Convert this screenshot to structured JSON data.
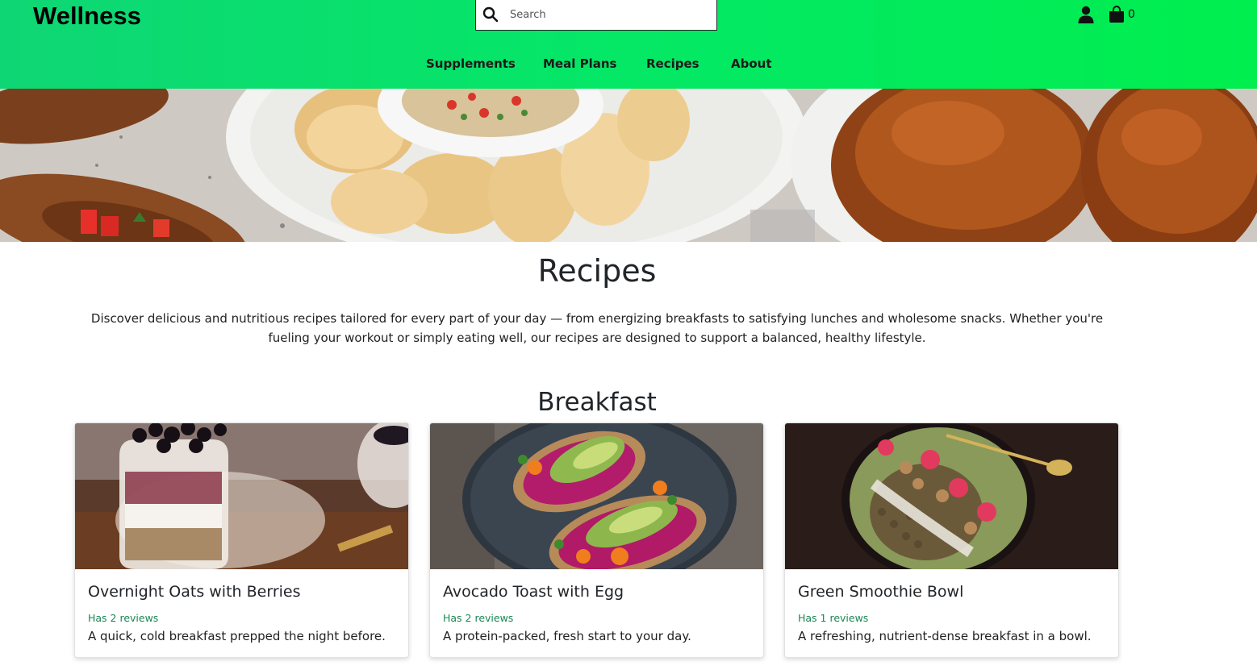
{
  "header": {
    "brand": "Wellness",
    "search": {
      "placeholder": "Search",
      "value": ""
    },
    "cart_count": "0",
    "accent_colors": [
      "#0fd675",
      "#00ee4e"
    ]
  },
  "nav": {
    "items": [
      {
        "label": "Supplements"
      },
      {
        "label": "Meal Plans"
      },
      {
        "label": "Recipes"
      },
      {
        "label": "About"
      }
    ]
  },
  "page": {
    "title": "Recipes",
    "intro": "Discover delicious and nutritious recipes tailored for every part of your day — from energizing breakfasts to satisfying lunches and wholesome snacks. Whether you're fueling your workout or simply eating well, our recipes are designed to support a balanced, healthy lifestyle."
  },
  "sections": [
    {
      "title": "Breakfast",
      "cards": [
        {
          "title": "Overnight Oats with Berries",
          "reviews": "Has 2 reviews",
          "description": "A quick, cold breakfast prepped the night before."
        },
        {
          "title": "Avocado Toast with Egg",
          "reviews": "Has 2 reviews",
          "description": "A protein-packed, fresh start to your day."
        },
        {
          "title": "Green Smoothie Bowl",
          "reviews": "Has 1 reviews",
          "description": "A refreshing, nutrient-dense breakfast in a bowl."
        }
      ]
    }
  ],
  "icons": {
    "search": "search-icon",
    "user": "user-icon",
    "cart": "shopping-bag-icon"
  }
}
